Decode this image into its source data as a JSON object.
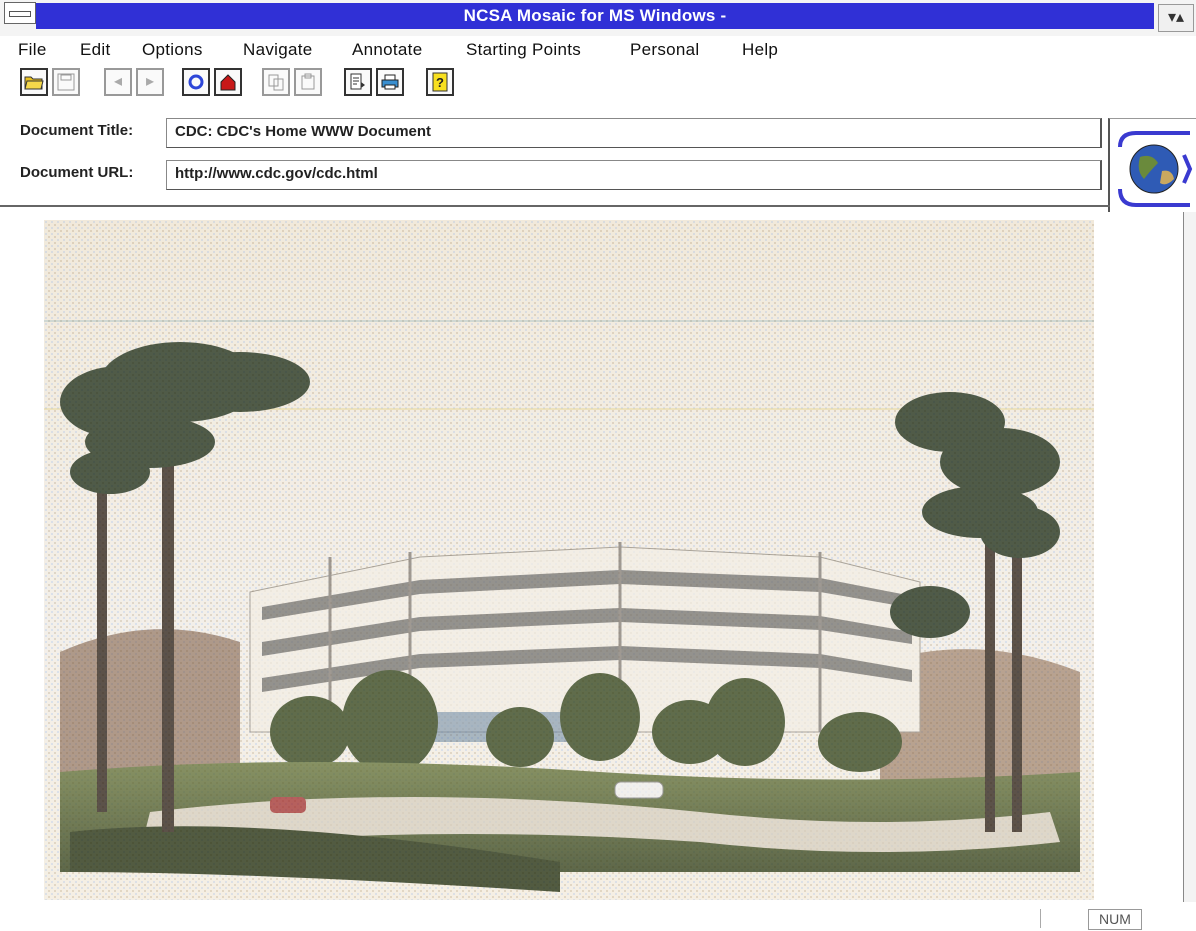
{
  "window": {
    "title": "NCSA Mosaic for MS Windows -",
    "accent_color": "#3030d6"
  },
  "menu": {
    "items": [
      "File",
      "Edit",
      "Options",
      "Navigate",
      "Annotate",
      "Starting Points",
      "Personal",
      "Help"
    ]
  },
  "toolbar": {
    "buttons": [
      {
        "name": "open-icon"
      },
      {
        "name": "save-icon"
      },
      {
        "name": "back-arrow-icon"
      },
      {
        "name": "forward-arrow-icon"
      },
      {
        "name": "reload-icon"
      },
      {
        "name": "home-icon"
      },
      {
        "name": "copy-icon"
      },
      {
        "name": "paste-icon"
      },
      {
        "name": "find-icon"
      },
      {
        "name": "print-icon"
      },
      {
        "name": "help-icon"
      }
    ]
  },
  "document": {
    "title_label": "Document Title:",
    "title_value": "CDC: CDC's Home WWW Document",
    "url_label": "Document URL:",
    "url_value": "http://www.cdc.gov/cdc.html"
  },
  "status": {
    "num_indicator": "NUM"
  }
}
